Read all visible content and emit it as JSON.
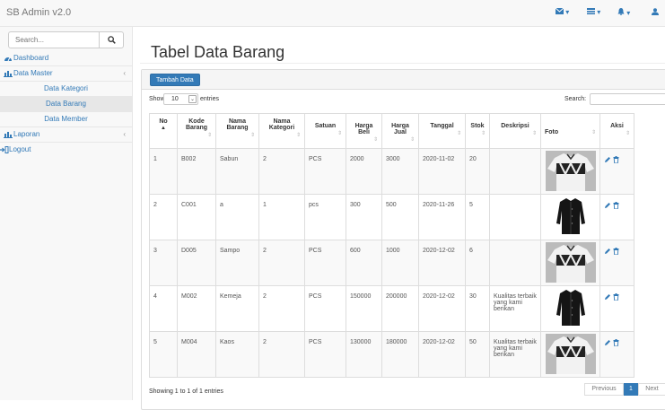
{
  "app": {
    "brand": "SB Admin v2.0"
  },
  "topbar": {
    "icons": [
      "envelope-icon",
      "tasks-icon",
      "bell-icon",
      "user-icon"
    ]
  },
  "sidebar": {
    "search_placeholder": "Search...",
    "items": [
      {
        "label": "Dashboard",
        "icon": "dashboard-icon"
      },
      {
        "label": "Data Master",
        "icon": "bar-chart-icon",
        "chevron": "‹"
      },
      {
        "label": "Laporan",
        "icon": "bar-chart-icon",
        "chevron": "‹"
      },
      {
        "label": "Logout",
        "icon": "logout-icon"
      }
    ],
    "sub_items": [
      {
        "label": "Data Kategori",
        "active": false
      },
      {
        "label": "Data Barang",
        "active": true
      },
      {
        "label": "Data Member",
        "active": false
      }
    ]
  },
  "main": {
    "title": "Tabel Data Barang",
    "add_button": "Tambah Data",
    "length": {
      "show": "Show",
      "value": "10",
      "entries": "entries"
    },
    "search_label": "Search:",
    "table": {
      "headers": [
        "No",
        "Kode Barang",
        "Nama Barang",
        "Nama Kategori",
        "Satuan",
        "Harga Beli",
        "Harga Jual",
        "Tanggal",
        "Stok",
        "Deskripsi",
        "Foto",
        "Aksi"
      ],
      "rows": [
        [
          "1",
          "B002",
          "Sabun",
          "2",
          "PCS",
          "2000",
          "3000",
          "2020-11-02",
          "20",
          "",
          "white-shirt"
        ],
        [
          "2",
          "C001",
          "a",
          "1",
          "pcs",
          "300",
          "500",
          "2020-11-26",
          "5",
          "",
          "black-shirt"
        ],
        [
          "3",
          "D005",
          "Sampo",
          "2",
          "PCS",
          "600",
          "1000",
          "2020-12-02",
          "6",
          "",
          "white-shirt"
        ],
        [
          "4",
          "M002",
          "Kemeja",
          "2",
          "PCS",
          "150000",
          "200000",
          "2020-12-02",
          "30",
          "Kualitas terbaik yang kami berikan",
          "black-shirt"
        ],
        [
          "5",
          "M004",
          "Kaos",
          "2",
          "PCS",
          "130000",
          "180000",
          "2020-12-02",
          "50",
          "Kualitas terbaik yang kami berikan",
          "white-shirt"
        ]
      ]
    },
    "info": "Showing 1 to 1 of 1 entries",
    "pagination": {
      "previous": "Previous",
      "page": "1",
      "next": "Next"
    }
  },
  "colors": {
    "primary": "#337ab7",
    "link": "#337ab7",
    "sidebar_bg": "#f8f8f8",
    "active_item": "#e7e7e7"
  }
}
